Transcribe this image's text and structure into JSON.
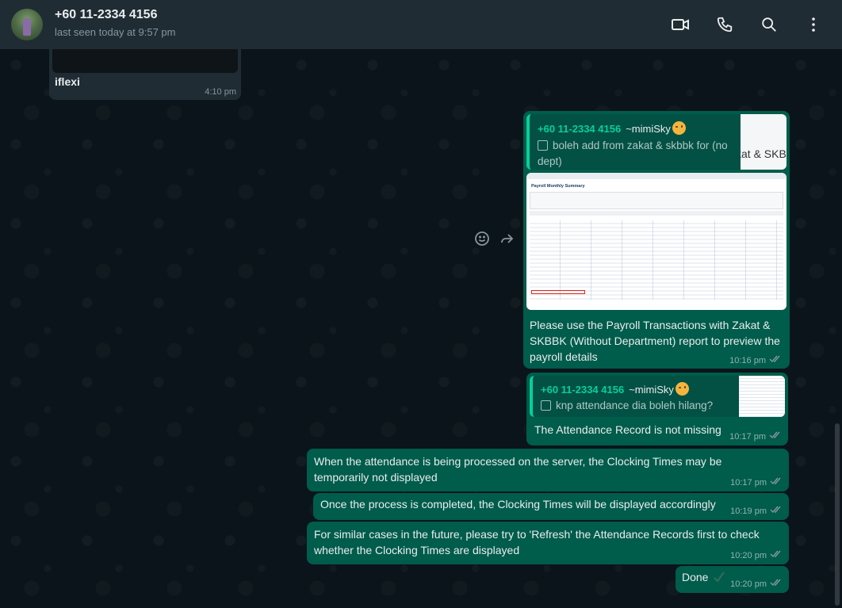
{
  "header": {
    "contact_name": "+60 11-2334 4156",
    "status": "last seen today at 9:57 pm",
    "icons": [
      "video-call-icon",
      "voice-call-icon",
      "search-icon",
      "menu-icon"
    ]
  },
  "colors": {
    "header_bg": "#202c33",
    "chat_bg": "#0b141a",
    "outgoing_bubble": "#005c4b",
    "incoming_bubble": "#202c33",
    "quote_accent": "#06cf9c",
    "tick_color": "#8696a0"
  },
  "messages": {
    "incoming_1": {
      "text": "iflexi",
      "time": "4:10 pm"
    },
    "reply_1": {
      "quote_name": "+60 11-2334 4156",
      "quote_alias": "~mimiSky",
      "quote_text": "boleh add from zakat & skbbk for (no dept)",
      "quote_thumb_text": "kat & SKBB",
      "screenshot_title": "Payroll Monthly Summary",
      "text": "Please use the Payroll Transactions with Zakat & SKBBK (Without Department) report to preview the payroll details",
      "time": "10:16 pm"
    },
    "reply_2": {
      "quote_name": "+60 11-2334 4156",
      "quote_alias": "~mimiSky",
      "quote_text": "knp attendance dia boleh hilang?",
      "text": "The Attendance Record is not missing",
      "time": "10:17 pm"
    },
    "msg_3": {
      "text": "When the attendance is being processed on the server, the Clocking Times may be temporarily not displayed",
      "time": "10:17 pm"
    },
    "msg_4": {
      "text": "Once the process is completed, the Clocking Times will be displayed accordingly",
      "time": "10:19 pm"
    },
    "msg_5": {
      "text": "For similar cases in the future, please try to 'Refresh' the Attendance Records first to check whether the Clocking Times are displayed",
      "time": "10:20 pm"
    },
    "msg_6": {
      "text": "Done",
      "time": "10:20 pm"
    }
  }
}
